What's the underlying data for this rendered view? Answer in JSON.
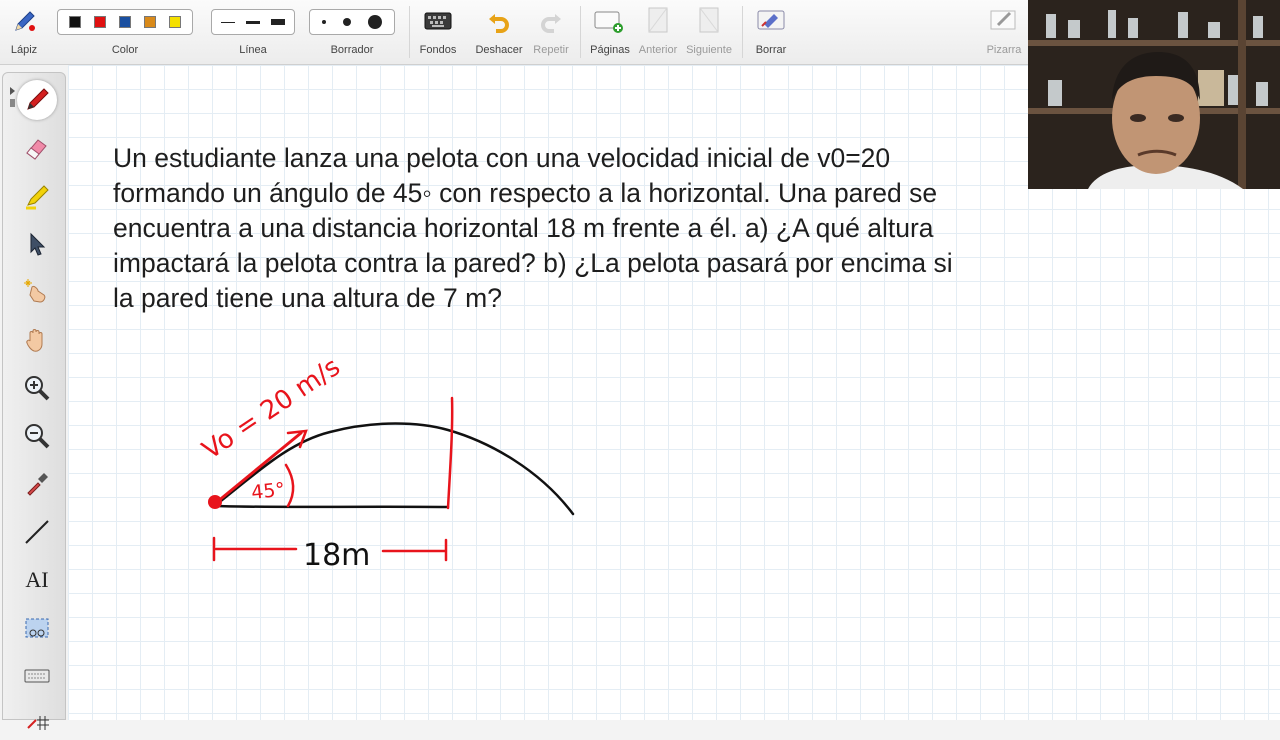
{
  "toolbar": {
    "pencil_label": "Lápiz",
    "color_label": "Color",
    "line_label": "Línea",
    "eraser_label": "Borrador",
    "backgrounds_label": "Fondos",
    "undo_label": "Deshacer",
    "redo_label": "Repetir",
    "pages_label": "Páginas",
    "prev_label": "Anterior",
    "next_label": "Siguiente",
    "clear_label": "Borrar",
    "board_label": "Pizarra",
    "colors": [
      "#111111",
      "#e01010",
      "#1a4fa0",
      "#d98a1a",
      "#f5e000"
    ]
  },
  "left_tools": [
    "pen-icon",
    "highlighter-eraser-icon",
    "highlighter-icon",
    "pointer-icon",
    "magic-pointer-icon",
    "hand-icon",
    "zoom-in-icon",
    "zoom-out-icon",
    "eyedropper-icon",
    "line-tool-icon",
    "text-tool-icon",
    "screenshot-icon",
    "keyboard-icon",
    "grid-icon"
  ],
  "text_tool_label": "AI",
  "problem": {
    "line1": "Un estudiante lanza una pelota con una velocidad inicial de v0=20",
    "line2": "formando un ángulo de 45◦ con respecto a la horizontal. Una pared se",
    "line3": "encuentra a una distancia horizontal 18 m frente a él. a) ¿A qué altura",
    "line4": "impactará la pelota contra la pared? b) ¿La pelota pasará por encima si",
    "line5": "la pared tiene una altura de 7 m?"
  },
  "sketch": {
    "velocity_label": "Vo = 20 m/s",
    "angle_label": "45°",
    "distance_label": "18m",
    "ink_red": "#e8141c",
    "ink_black": "#111111"
  }
}
